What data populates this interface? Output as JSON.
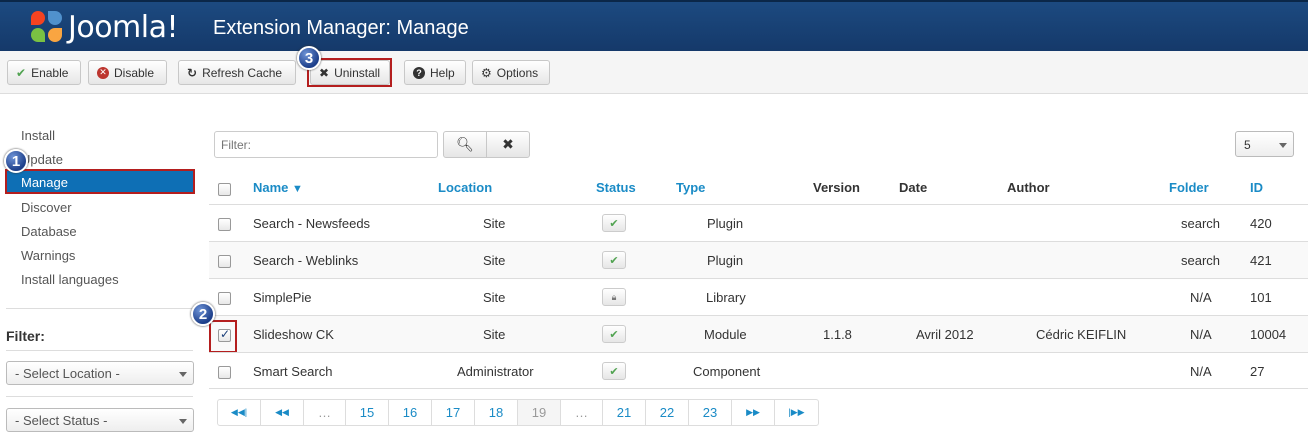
{
  "header": {
    "logo_text": "Joomla!",
    "title": "Extension Manager: Manage"
  },
  "toolbar": {
    "enable": "Enable",
    "disable": "Disable",
    "refresh": "Refresh Cache",
    "uninstall": "Uninstall",
    "help": "Help",
    "options": "Options"
  },
  "badges": {
    "one": "1",
    "two": "2",
    "three": "3"
  },
  "sidebar": {
    "items": [
      "Install",
      "Update",
      "Manage",
      "Discover",
      "Database",
      "Warnings",
      "Install languages"
    ],
    "active": "Manage",
    "filter_heading": "Filter:",
    "select_location": "- Select Location -",
    "select_status": "- Select Status -"
  },
  "filterbar": {
    "placeholder": "Filter:",
    "limit": "5"
  },
  "table": {
    "headers": {
      "name": "Name",
      "location": "Location",
      "status": "Status",
      "type": "Type",
      "version": "Version",
      "date": "Date",
      "author": "Author",
      "folder": "Folder",
      "id": "ID"
    },
    "rows": [
      {
        "name": "Search - Newsfeeds",
        "location": "Site",
        "status": "enabled",
        "type": "Plugin",
        "version": "",
        "date": "",
        "author": "",
        "folder": "search",
        "id": "420",
        "checked": false
      },
      {
        "name": "Search - Weblinks",
        "location": "Site",
        "status": "enabled",
        "type": "Plugin",
        "version": "",
        "date": "",
        "author": "",
        "folder": "search",
        "id": "421",
        "checked": false
      },
      {
        "name": "SimplePie",
        "location": "Site",
        "status": "locked",
        "type": "Library",
        "version": "",
        "date": "",
        "author": "",
        "folder": "N/A",
        "id": "101",
        "checked": false
      },
      {
        "name": "Slideshow CK",
        "location": "Site",
        "status": "enabled",
        "type": "Module",
        "version": "1.1.8",
        "date": "Avril 2012",
        "author": "Cédric KEIFLIN",
        "folder": "N/A",
        "id": "10004",
        "checked": true
      },
      {
        "name": "Smart Search",
        "location": "Administrator",
        "status": "enabled",
        "type": "Component",
        "version": "",
        "date": "",
        "author": "",
        "folder": "N/A",
        "id": "27",
        "checked": false
      }
    ]
  },
  "pagination": {
    "pages": [
      "15",
      "16",
      "17",
      "18",
      "19",
      "21",
      "22",
      "23"
    ],
    "current": "19",
    "ellipsis": "…"
  },
  "colors": {
    "header": "#1c4a80",
    "accent": "#0e6fb5",
    "link": "#1a8bc6",
    "highlight": "#b41e1e"
  }
}
